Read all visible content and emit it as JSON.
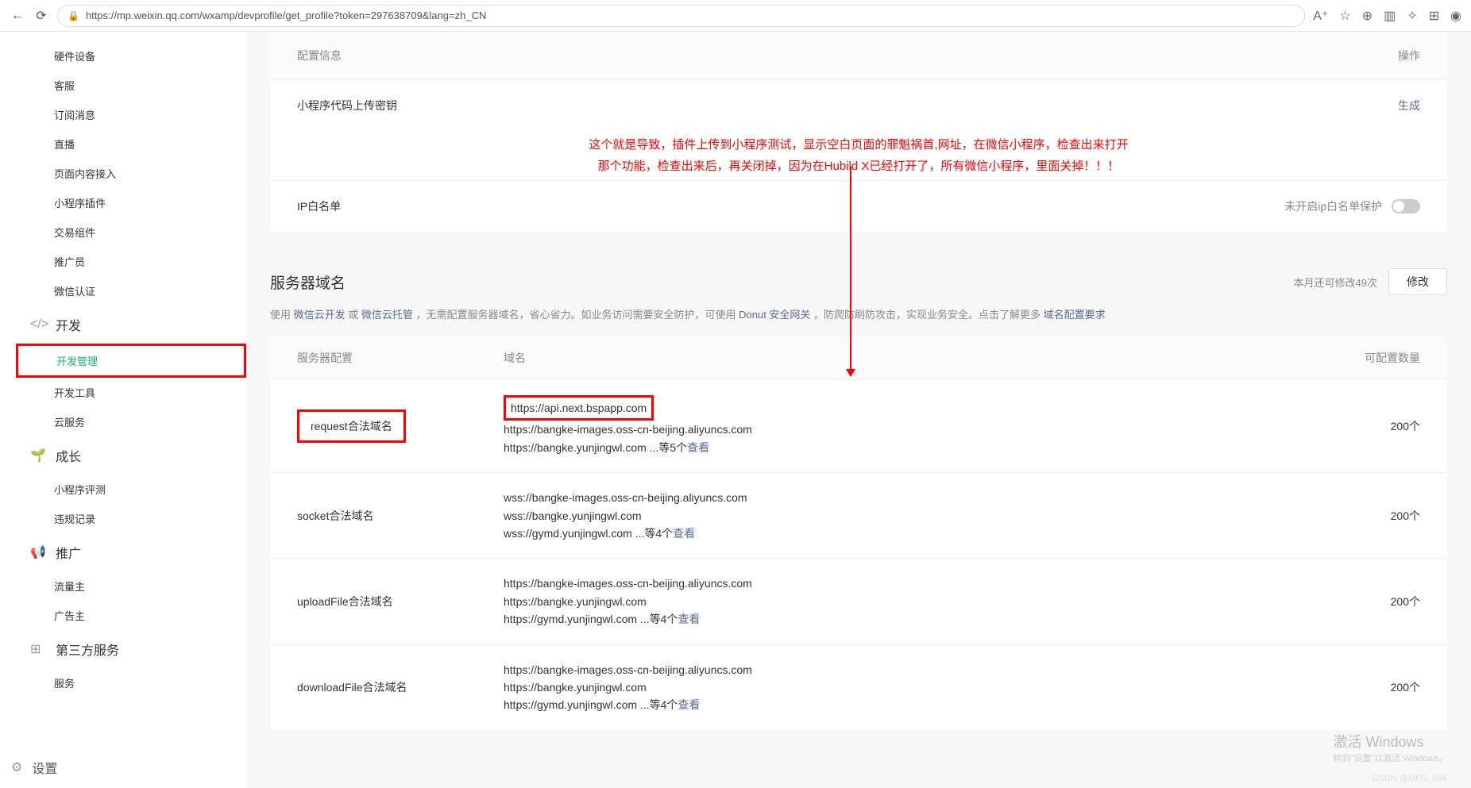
{
  "browser": {
    "url": "https://mp.weixin.qq.com/wxamp/devprofile/get_profile?token=297638709&lang=zh_CN"
  },
  "sidebar": {
    "group1_items": [
      "硬件设备",
      "客服",
      "订阅消息",
      "直播",
      "页面内容接入",
      "小程序插件",
      "交易组件",
      "推广员",
      "微信认证"
    ],
    "dev": {
      "title": "开发",
      "items": [
        "开发管理",
        "开发工具",
        "云服务"
      ]
    },
    "growth": {
      "title": "成长",
      "items": [
        "小程序评测",
        "违规记录"
      ]
    },
    "promo": {
      "title": "推广",
      "items": [
        "流量主",
        "广告主"
      ]
    },
    "third": {
      "title": "第三方服务",
      "items": [
        "服务"
      ]
    },
    "settings": "设置"
  },
  "config_card": {
    "head_left": "配置信息",
    "head_right": "操作",
    "row1_label": "小程序代码上传密钥",
    "row1_action": "生成",
    "note_line1": "这个就是导致，插件上传到小程序测试，显示空白页面的罪魁祸首,网址，在微信小程序，检查出来打开",
    "note_line2": "那个功能，检查出来后，再关闭掉，因为在Hubild X已经打开了，所有微信小程序，里面关掉！！！",
    "row2_label": "IP白名单",
    "row2_right": "未开启ip白名单保护"
  },
  "domain_section": {
    "title": "服务器域名",
    "remain": "本月还可修改49次",
    "modify_btn": "修改",
    "desc_parts": {
      "p1": "使用 ",
      "l1": "微信云开发",
      "p2": " 或 ",
      "l2": "微信云托管",
      "p3": " ，无需配置服务器域名，省心省力。如业务访问需要安全防护，可使用 ",
      "l3": "Donut 安全网关",
      "p4": " ，防爬防刷防攻击，实现业务安全。点击了解更多 ",
      "l4": "域名配置要求"
    },
    "th": {
      "c1": "服务器配置",
      "c2": "域名",
      "c3": "可配置数量"
    },
    "rows": [
      {
        "label": "request合法域名",
        "domains": [
          "https://api.next.bspapp.com",
          "https://bangke-images.oss-cn-beijing.aliyuncs.com",
          "https://bangke.yunjingwl.com ...等5个"
        ],
        "more": "查看",
        "count": "200个",
        "hi_label": true,
        "hi_first": true
      },
      {
        "label": "socket合法域名",
        "domains": [
          "wss://bangke-images.oss-cn-beijing.aliyuncs.com",
          "wss://bangke.yunjingwl.com",
          "wss://gymd.yunjingwl.com ...等4个"
        ],
        "more": "查看",
        "count": "200个"
      },
      {
        "label": "uploadFile合法域名",
        "domains": [
          "https://bangke-images.oss-cn-beijing.aliyuncs.com",
          "https://bangke.yunjingwl.com",
          "https://gymd.yunjingwl.com ...等4个"
        ],
        "more": "查看",
        "count": "200个"
      },
      {
        "label": "downloadFile合法域名",
        "domains": [
          "https://bangke-images.oss-cn-beijing.aliyuncs.com",
          "https://bangke.yunjingwl.com",
          "https://gymd.yunjingwl.com ...等4个"
        ],
        "more": "查看",
        "count": "200个"
      }
    ]
  },
  "watermark": {
    "line1": "激活 Windows",
    "line2": "转到\"设置\"以激活 Windows。"
  },
  "csdn": "CSDN @MFG_666"
}
